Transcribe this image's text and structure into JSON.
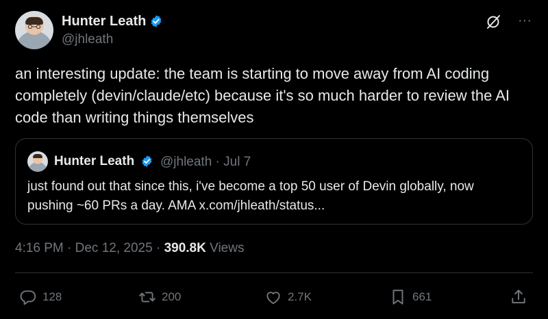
{
  "post": {
    "author_name": "Hunter Leath",
    "handle": "@jhleath",
    "text": "an interesting update: the team is starting to move away from AI coding completely (devin/claude/etc) because it's so much harder to review the AI code than writing things themselves",
    "timestamp": "4:16 PM · Dec 12, 2025 · ",
    "views_count": "390.8K",
    "views_label": " Views"
  },
  "quote": {
    "author_name": "Hunter Leath",
    "meta": "@jhleath · Jul 7",
    "text": "just found out that since this, i've become a top 50 user of Devin globally, now pushing ~60 PRs a day. AMA x.com/jhleath/status..."
  },
  "actions": {
    "replies": "128",
    "reposts": "200",
    "likes": "2.7K",
    "bookmarks": "661"
  },
  "icons": {
    "verified": "verified-badge-icon",
    "grok": "grok-icon",
    "more": "more-icon",
    "reply": "reply-icon",
    "repost": "repost-icon",
    "like": "heart-icon",
    "bookmark": "bookmark-icon",
    "share": "share-icon"
  },
  "colors": {
    "background": "#000000",
    "text": "#e7e9ea",
    "muted": "#71767b",
    "border": "#2f3336",
    "verified": "#1d9bf0"
  }
}
